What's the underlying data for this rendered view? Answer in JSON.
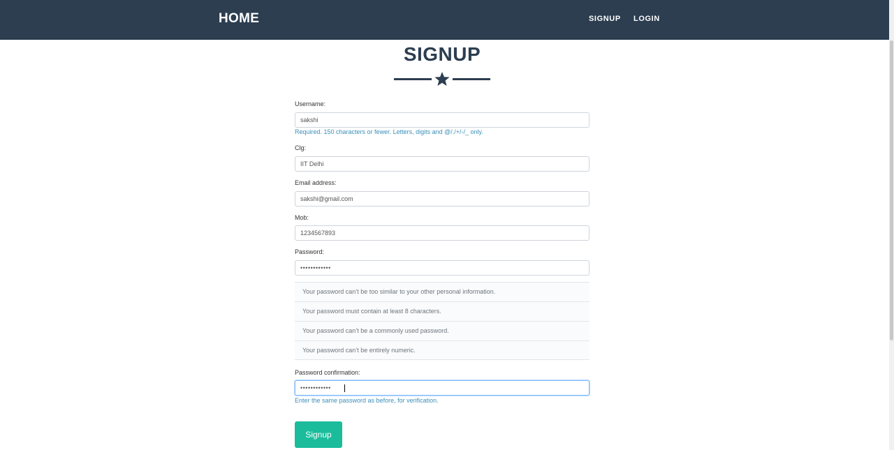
{
  "nav": {
    "brand": "HOME",
    "links": [
      "SIGNUP",
      "LOGIN"
    ]
  },
  "page": {
    "title": "SIGNUP",
    "divider_icon": "star-icon"
  },
  "form": {
    "username": {
      "label": "Username:",
      "value": "sakshi",
      "help": "Required. 150 characters or fewer. Letters, digits and @/./+/-/_ only."
    },
    "clg": {
      "label": "Clg:",
      "value": "IIT Delhi"
    },
    "email": {
      "label": "Email address:",
      "value": "sakshi@gmail.com"
    },
    "mob": {
      "label": "Mob:",
      "value": "1234567893"
    },
    "password": {
      "label": "Password:",
      "value": "••••••••••••",
      "rules": [
        "Your password can’t be too similar to your other personal information.",
        "Your password must contain at least 8 characters.",
        "Your password can’t be a commonly used password.",
        "Your password can’t be entirely numeric."
      ]
    },
    "password_confirm": {
      "label": "Password confirmation:",
      "value": "••••••••••••",
      "help": "Enter the same password as before, for verification."
    },
    "submit_label": "Signup"
  },
  "colors": {
    "navbar": "#2c3e50",
    "accent": "#1abc9c",
    "help_text": "#3a8fb7"
  }
}
